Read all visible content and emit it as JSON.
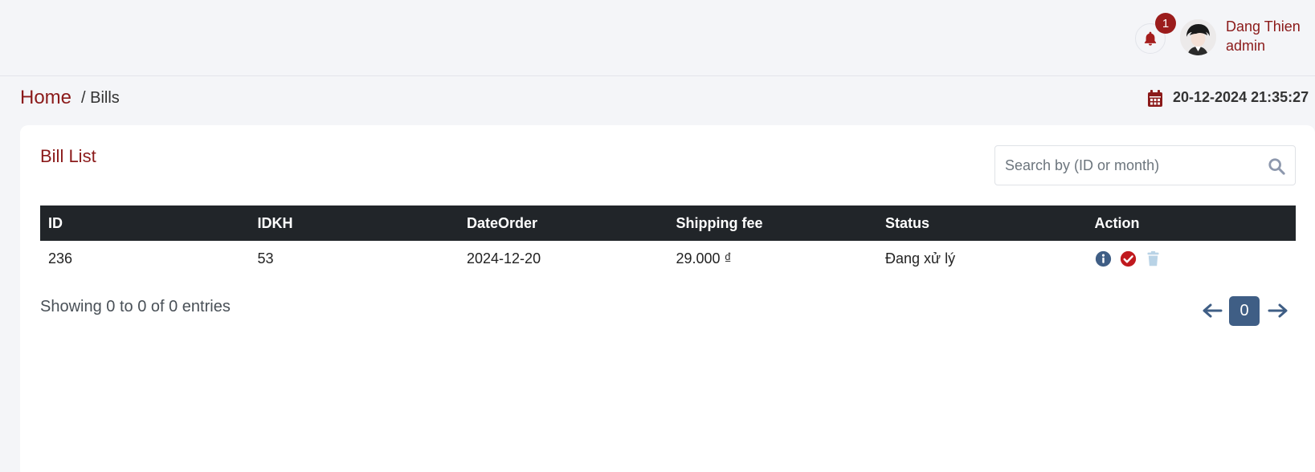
{
  "header": {
    "notification_count": "1",
    "user_name": "Dang Thien",
    "user_role": "admin"
  },
  "breadcrumb": {
    "home": "Home",
    "current": "/ Bills"
  },
  "datetime": "20-12-2024 21:35:27",
  "card": {
    "title": "Bill List",
    "search_placeholder": "Search by (ID or month)"
  },
  "table": {
    "headers": [
      "ID",
      "IDKH",
      "DateOrder",
      "Shipping fee",
      "Status",
      "Action"
    ],
    "rows": [
      {
        "id": "236",
        "idkh": "53",
        "date": "2024-12-20",
        "fee": "29.000 ₫",
        "status": "Đang xử lý"
      }
    ]
  },
  "footer": {
    "entries_text": "Showing 0 to 0 of 0 entries",
    "current_page": "0"
  },
  "colors": {
    "brand": "#8b1a1a",
    "table_header": "#212529",
    "pager_active": "#3f5e85"
  }
}
